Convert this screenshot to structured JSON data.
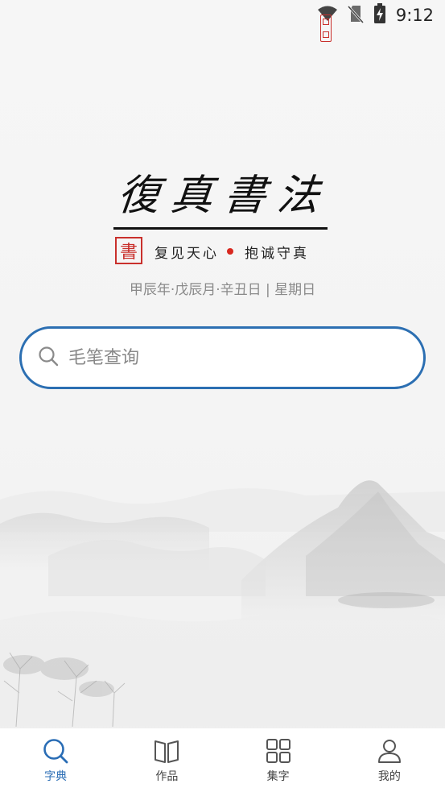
{
  "status_bar": {
    "time": "9:12",
    "icons": [
      "wifi-icon",
      "no-sim-icon",
      "battery-charging-icon"
    ]
  },
  "logo": {
    "title": "復真書法",
    "seal_big_char": "書"
  },
  "motto": {
    "left": "复见天心",
    "right": "抱诚守真",
    "dot_color": "#d8281f"
  },
  "date_text": "甲辰年·戊辰月·辛丑日 | 星期日",
  "search": {
    "placeholder": "毛笔查询",
    "value": "",
    "icon": "search-icon",
    "border_color": "#2c6fb2"
  },
  "bottom_nav": {
    "active_color": "#2a6db5",
    "items": [
      {
        "label": "字典",
        "icon": "search-icon",
        "active": true
      },
      {
        "label": "作品",
        "icon": "book-icon",
        "active": false
      },
      {
        "label": "集字",
        "icon": "grid-icon",
        "active": false
      },
      {
        "label": "我的",
        "icon": "user-icon",
        "active": false
      }
    ]
  }
}
